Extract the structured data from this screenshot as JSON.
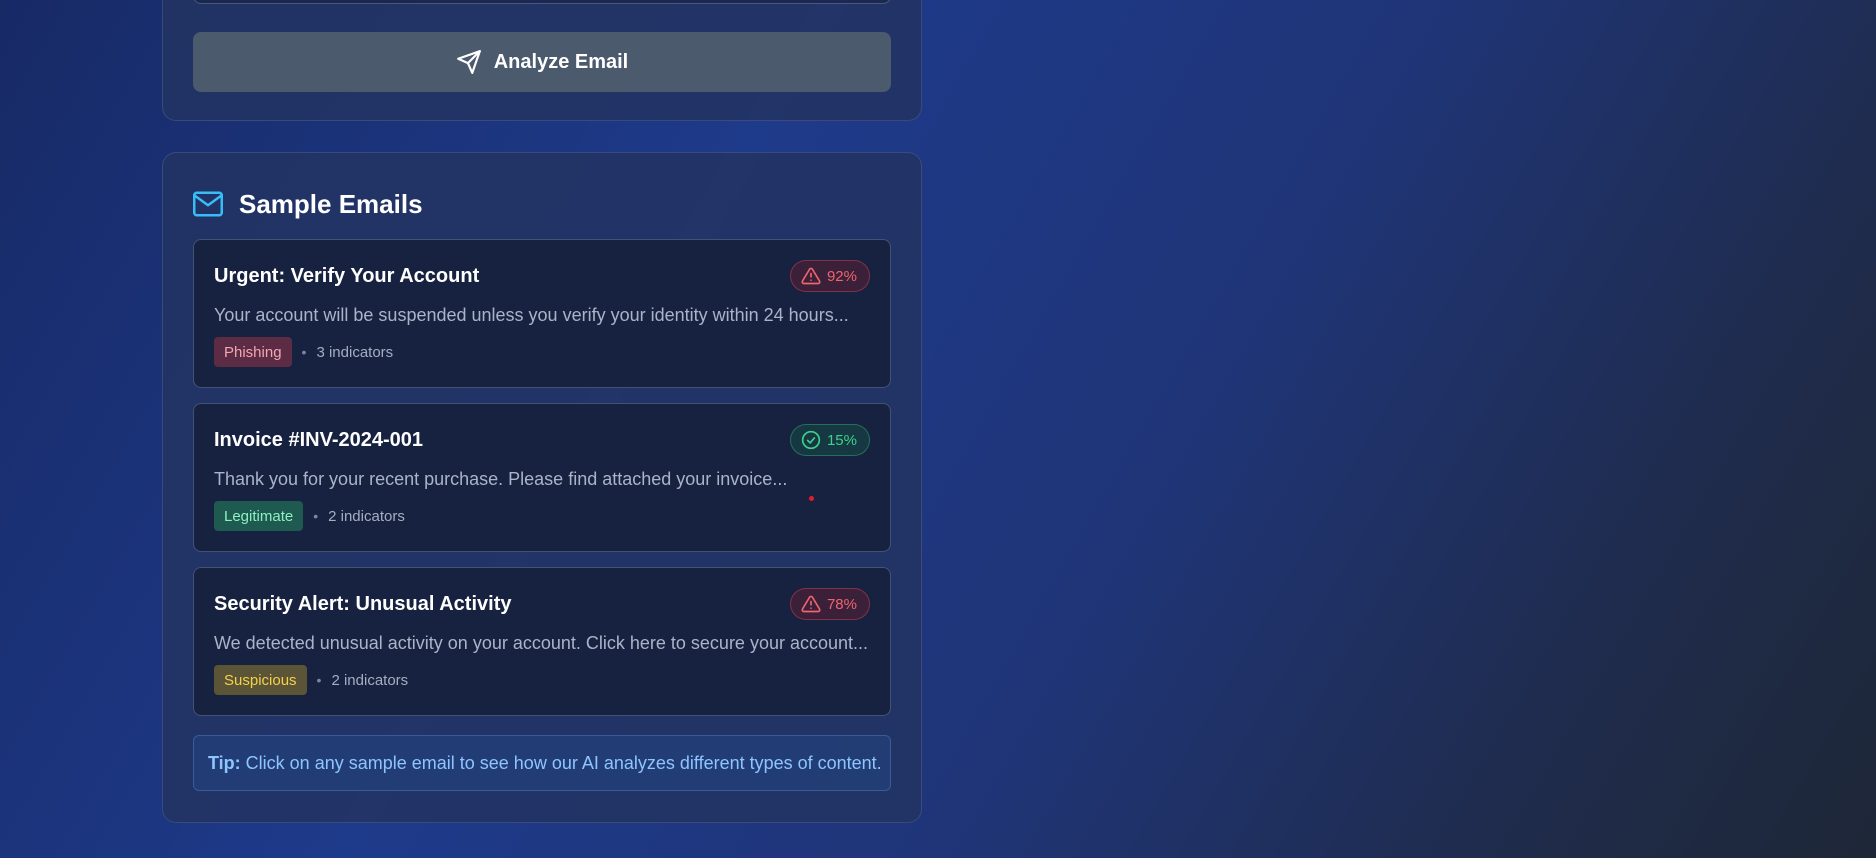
{
  "analyze": {
    "button_label": "Analyze Email",
    "button_icon": "send-icon"
  },
  "samples": {
    "title": "Sample Emails",
    "title_icon": "mail-icon",
    "items": [
      {
        "title": "Urgent: Verify Your Account",
        "preview": "Your account will be suspended unless you verify your identity within 24 hours...",
        "risk": "92%",
        "risk_icon": "alert-triangle-icon",
        "tag": "Phishing",
        "separator": "•",
        "indicators": "3 indicators"
      },
      {
        "title": "Invoice #INV-2024-001",
        "preview": "Thank you for your recent purchase. Please find attached your invoice...",
        "risk": "15%",
        "risk_icon": "check-circle-icon",
        "tag": "Legitimate",
        "separator": "•",
        "indicators": "2 indicators"
      },
      {
        "title": "Security Alert: Unusual Activity",
        "preview": "We detected unusual activity on your account. Click here to secure your account...",
        "risk": "78%",
        "risk_icon": "alert-triangle-icon",
        "tag": "Suspicious",
        "separator": "•",
        "indicators": "2 indicators"
      }
    ],
    "tip": {
      "label": "Tip:",
      "text": "Click on any sample email to see how our AI analyzes different types of content."
    }
  },
  "colors": {
    "phishing": "#f0646e",
    "legitimate": "#3fd08a",
    "suspicious": "#f3d24a",
    "accent": "#38bdf8"
  }
}
